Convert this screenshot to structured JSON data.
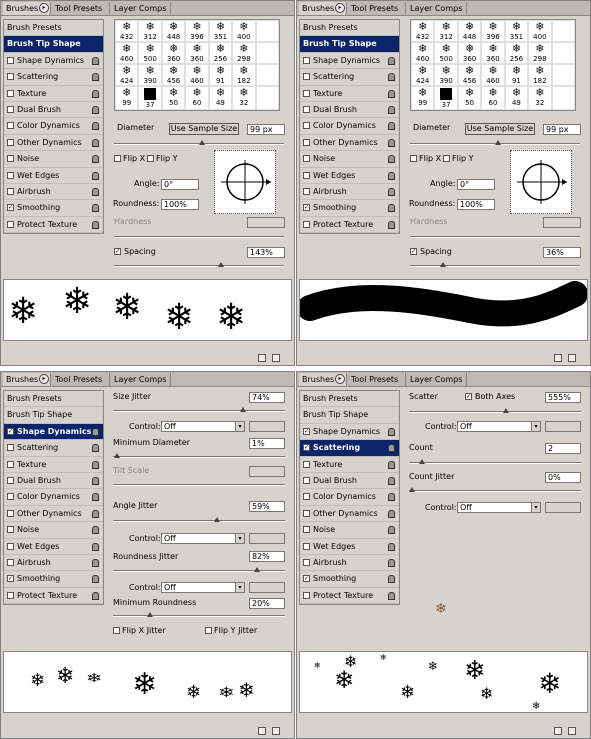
{
  "tabs": {
    "brushes": "Brushes",
    "tool_presets": "Tool Presets",
    "layer_comps": "Layer Comps"
  },
  "left_items": {
    "brush_presets": "Brush Presets",
    "brush_tip_shape": "Brush Tip Shape",
    "shape_dynamics": "Shape Dynamics",
    "scattering": "Scattering",
    "texture": "Texture",
    "dual_brush": "Dual Brush",
    "color_dynamics": "Color Dynamics",
    "other_dynamics": "Other Dynamics",
    "noise": "Noise",
    "wet_edges": "Wet Edges",
    "airbrush": "Airbrush",
    "smoothing": "Smoothing",
    "protect_texture": "Protect Texture"
  },
  "grid_numbers": [
    "432",
    "312",
    "448",
    "396",
    "351",
    "400",
    "",
    "460",
    "500",
    "360",
    "360",
    "256",
    "298",
    "",
    "424",
    "390",
    "456",
    "460",
    "91",
    "182",
    "",
    "99",
    "37",
    "50",
    "60",
    "49",
    "32",
    ""
  ],
  "tip": {
    "diameter_label": "Diameter",
    "use_sample_size": "Use Sample Size",
    "diameter_value": "99 px",
    "flip_x": "Flip X",
    "flip_y": "Flip Y",
    "angle_label": "Angle:",
    "angle_value": "0°",
    "roundness_label": "Roundness:",
    "roundness_value": "100%",
    "hardness_label": "Hardness",
    "spacing_label": "Spacing",
    "spacing_a": "143%",
    "spacing_b": "36%"
  },
  "shape_dynamics": {
    "size_jitter_label": "Size Jitter",
    "size_jitter_value": "74%",
    "control_label": "Control:",
    "control_value": "Off",
    "min_diameter_label": "Minimum Diameter",
    "min_diameter_value": "1%",
    "tilt_scale_label": "Tilt Scale",
    "angle_jitter_label": "Angle Jitter",
    "angle_jitter_value": "59%",
    "roundness_jitter_label": "Roundness Jitter",
    "roundness_jitter_value": "82%",
    "min_roundness_label": "Minimum Roundness",
    "min_roundness_value": "20%",
    "flip_x_jitter": "Flip X Jitter",
    "flip_y_jitter": "Flip Y Jitter"
  },
  "scattering": {
    "scatter_label": "Scatter",
    "both_axes": "Both Axes",
    "scatter_value": "555%",
    "control_label": "Control:",
    "control_value": "Off",
    "count_label": "Count",
    "count_value": "2",
    "count_jitter_label": "Count Jitter",
    "count_jitter_value": "0%"
  },
  "glyphs": {
    "flake": "❄",
    "check": "✓",
    "arrow": "▾"
  }
}
